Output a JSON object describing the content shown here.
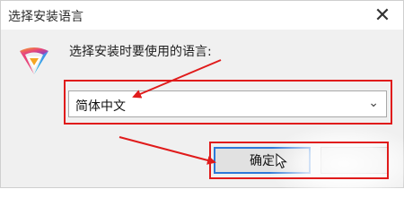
{
  "window": {
    "title": "选择安装语言",
    "close_glyph": "✕"
  },
  "prompt": {
    "text": "选择安装时要使用的语言:"
  },
  "language_select": {
    "selected": "简体中文",
    "chevron_glyph": "⌄"
  },
  "buttons": {
    "ok_label": "确定",
    "cancel_label": ""
  },
  "annotations": {
    "highlight_color": "#e01b1b",
    "focus_color": "#2b78d8"
  },
  "icons": {
    "app_logo": "app-logo-icon",
    "cursor": "mouse-cursor-icon"
  }
}
